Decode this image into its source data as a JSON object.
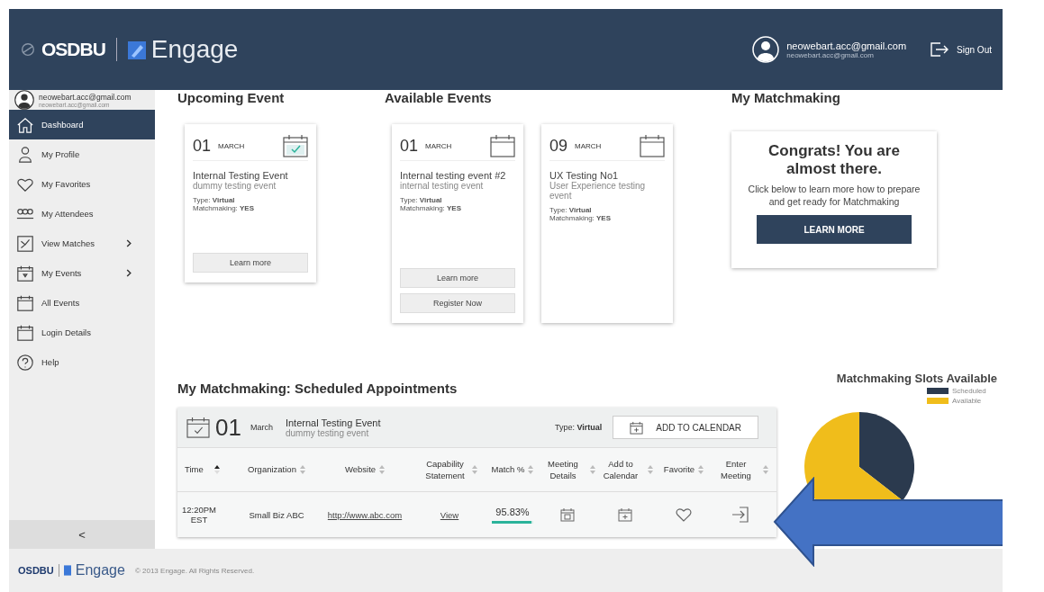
{
  "header": {
    "logo_left": "OSDBU",
    "logo_right": "Engage",
    "user_email": "neowebart.acc@gmail.com",
    "user_sub": "neowebart.acc@gmail.com",
    "sign_out": "Sign Out"
  },
  "sidebar": {
    "user_email": "neowebart.acc@gmail.com",
    "user_sub": "neowebart.acc@gmail.com",
    "items": [
      {
        "label": "Dashboard",
        "selected": true,
        "submenu": false
      },
      {
        "label": "My Profile",
        "selected": false,
        "submenu": false
      },
      {
        "label": "My Favorites",
        "selected": false,
        "submenu": false
      },
      {
        "label": "My Attendees",
        "selected": false,
        "submenu": false
      },
      {
        "label": "View Matches",
        "selected": false,
        "submenu": true
      },
      {
        "label": "My Events",
        "selected": false,
        "submenu": true
      },
      {
        "label": "All Events",
        "selected": false,
        "submenu": false
      },
      {
        "label": "Login Details",
        "selected": false,
        "submenu": false
      },
      {
        "label": "Help",
        "selected": false,
        "submenu": false
      }
    ],
    "collapse": "<"
  },
  "upcoming": {
    "heading": "Upcoming Event",
    "cards": [
      {
        "day": "01",
        "month": "MARCH",
        "registered": true,
        "title": "Internal Testing Event",
        "subtitle": "dummy testing event",
        "type": "Type: **Virtual**",
        "matchmaking": "Matchmaking: **YES**",
        "buttons": [
          "Learn more"
        ]
      }
    ]
  },
  "available": {
    "heading": "Available Events",
    "cards": [
      {
        "day": "01",
        "month": "MARCH",
        "registered": false,
        "title": "Internal testing event #2",
        "subtitle": "internal testing event",
        "type": "Type: **Virtual**",
        "matchmaking": "Matchmaking: **YES**",
        "buttons": [
          "Learn more",
          "Register Now"
        ]
      },
      {
        "day": "09",
        "month": "MARCH",
        "registered": false,
        "title": "UX Testing No1",
        "subtitle": "User Experience testing event",
        "type": "Type: **Virtual**",
        "matchmaking": "Matchmaking: **YES**"
      }
    ]
  },
  "matchmaking": {
    "heading": "My Matchmaking",
    "title": "Congrats! You are almost there.",
    "text": "Click below to learn more how to prepare and get ready for Matchmaking",
    "button": "LEARN MORE"
  },
  "appointments": {
    "heading": "My Matchmaking: Scheduled Appointments",
    "event": {
      "day": "01",
      "month": "March",
      "title": "Internal Testing Event",
      "subtitle": "dummy testing event",
      "type": "Type: **Virtual**",
      "button": "ADD TO CALENDAR"
    },
    "columns": [
      {
        "label": "Time",
        "sorted": true
      },
      {
        "label": "Organization",
        "sorted": false
      },
      {
        "label": "Website",
        "sorted": false
      },
      {
        "label": "Capability Statement",
        "sorted": false
      },
      {
        "label": "Match %",
        "sorted": false
      },
      {
        "label": "Meeting Details",
        "sorted": false
      },
      {
        "label": "Add to Calendar",
        "sorted": false
      },
      {
        "label": "Favorite",
        "sorted": false
      },
      {
        "label": "Enter Meeting",
        "sorted": false
      }
    ],
    "rows": [
      {
        "time": "12:20PM EST",
        "organization": "Small Biz ABC",
        "website": "http://www.abc.com",
        "capability": "View",
        "match": "95.83%",
        "level": 0.9583
      }
    ]
  },
  "slots": {
    "title": "Matchmaking Slots Available",
    "legend": [
      {
        "label": "Scheduled",
        "color": "#2b3a4e"
      },
      {
        "label": "Available",
        "color": "#f0bd1b"
      }
    ]
  },
  "footer": {
    "logo_left": "OSDBU",
    "logo_right": "Engage",
    "copyright": "© 2013 Engage. All Rights Reserved."
  }
}
